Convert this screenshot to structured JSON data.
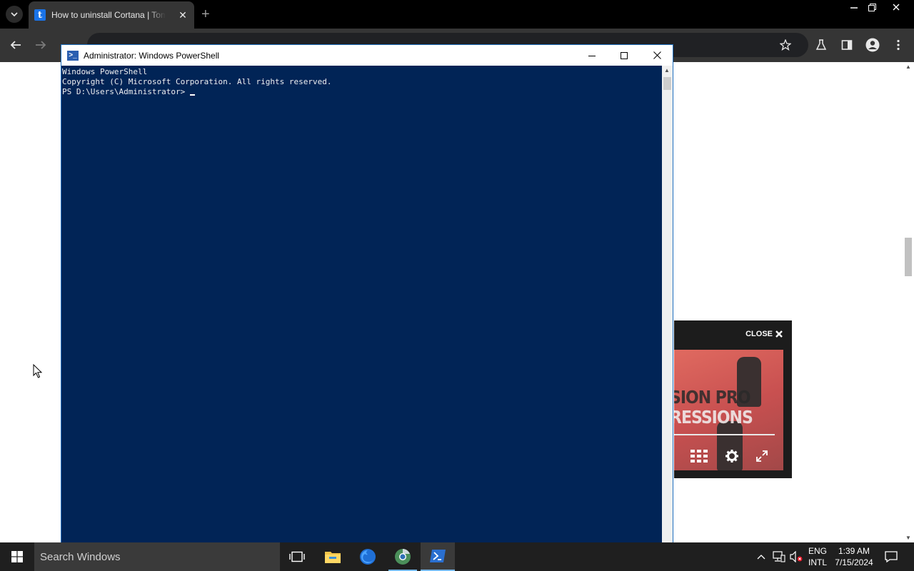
{
  "browser": {
    "tab_title": "How to uninstall Cortana | Tom's Hardware",
    "tab_favicon_letter": "t",
    "new_tab": "+",
    "tab_close": "✕"
  },
  "powershell": {
    "title": "Administrator: Windows PowerShell",
    "lines": [
      "Windows PowerShell",
      "Copyright (C) Microsoft Corporation. All rights reserved.",
      "",
      "PS D:\\Users\\Administrator> "
    ]
  },
  "video_ad": {
    "close_label": "CLOSE",
    "caption_line1": "SION PRO",
    "caption_line2": "RESSIONS"
  },
  "taskbar": {
    "search_placeholder": "Search Windows",
    "lang_line1": "ENG",
    "lang_line2": "INTL",
    "time": "1:39 AM",
    "date": "7/15/2024"
  },
  "colors": {
    "console_bg": "#012456",
    "browser_dark": "#353535",
    "taskbar": "#1f1f1f"
  }
}
